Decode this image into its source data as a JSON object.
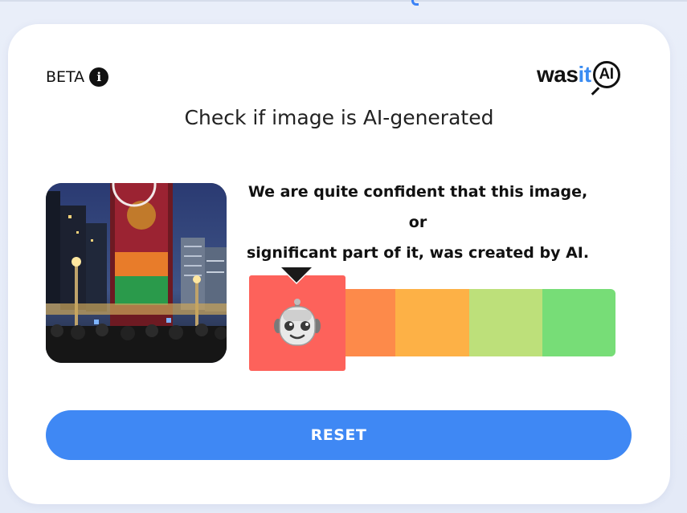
{
  "header": {
    "beta_label": "BETA",
    "info_icon": "info-icon",
    "logo": {
      "was": "was",
      "it": "it",
      "ai": "AI"
    }
  },
  "title": "Check if image is AI-generated",
  "result": {
    "verdict_line1": "We are quite confident that this image, or",
    "verdict_line2": "significant part of it, was created by AI.",
    "robot_icon": "robot-face-icon",
    "active_level": 1,
    "levels": [
      {
        "color": "#fd625b"
      },
      {
        "color": "#fd8a4a"
      },
      {
        "color": "#fdb146"
      },
      {
        "color": "#bde07a"
      },
      {
        "color": "#77dd77"
      }
    ]
  },
  "actions": {
    "reset_label": "RESET"
  }
}
